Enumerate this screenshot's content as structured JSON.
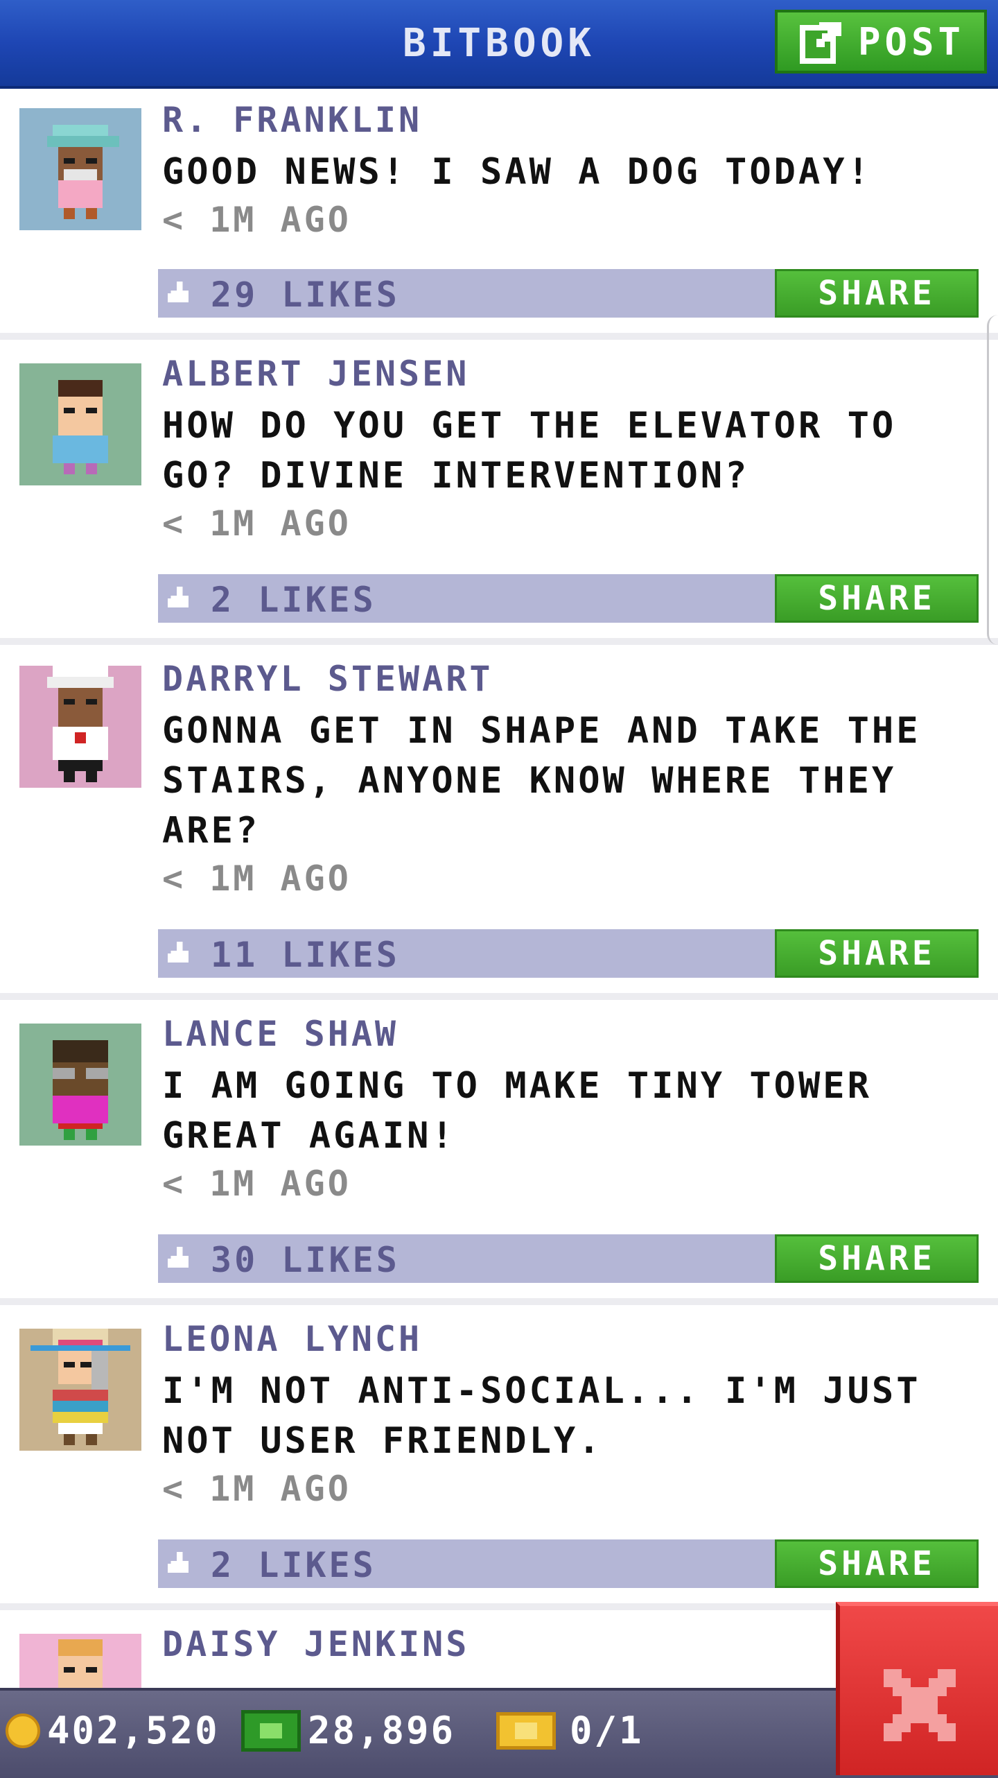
{
  "header": {
    "title": "BITBOOK",
    "post_label": "POST"
  },
  "posts": [
    {
      "name": "R. FRANKLIN",
      "message": "GOOD NEWS! I SAW A DOG TODAY!",
      "time": "< 1M AGO",
      "likes": "29 LIKES",
      "share": "SHARE"
    },
    {
      "name": "ALBERT JENSEN",
      "message": "HOW DO YOU GET THE ELEVATOR TO GO? DIVINE INTERVENTION?",
      "time": "< 1M AGO",
      "likes": "2 LIKES",
      "share": "SHARE"
    },
    {
      "name": "DARRYL STEWART",
      "message": "GONNA GET IN SHAPE AND TAKE THE STAIRS, ANYONE KNOW WHERE THEY ARE?",
      "time": "< 1M AGO",
      "likes": "11 LIKES",
      "share": "SHARE"
    },
    {
      "name": "LANCE SHAW",
      "message": "I AM GOING TO MAKE TINY TOWER GREAT AGAIN!",
      "time": "< 1M AGO",
      "likes": "30 LIKES",
      "share": "SHARE"
    },
    {
      "name": "LEONA LYNCH",
      "message": "I'M NOT ANTI-SOCIAL... I'M JUST NOT USER FRIENDLY.",
      "time": "< 1M AGO",
      "likes": "2 LIKES",
      "share": "SHARE"
    },
    {
      "name": "DAISY JENKINS"
    }
  ],
  "status_bar": {
    "coins": "402,520",
    "bux": "28,896",
    "tickets": "0/1"
  },
  "colors": {
    "header_blue": "#1e46b4",
    "accent_green": "#3a9d26",
    "like_bar": "#b4b6d6",
    "name_purple": "#5c5a8e",
    "close_red": "#d02424"
  }
}
